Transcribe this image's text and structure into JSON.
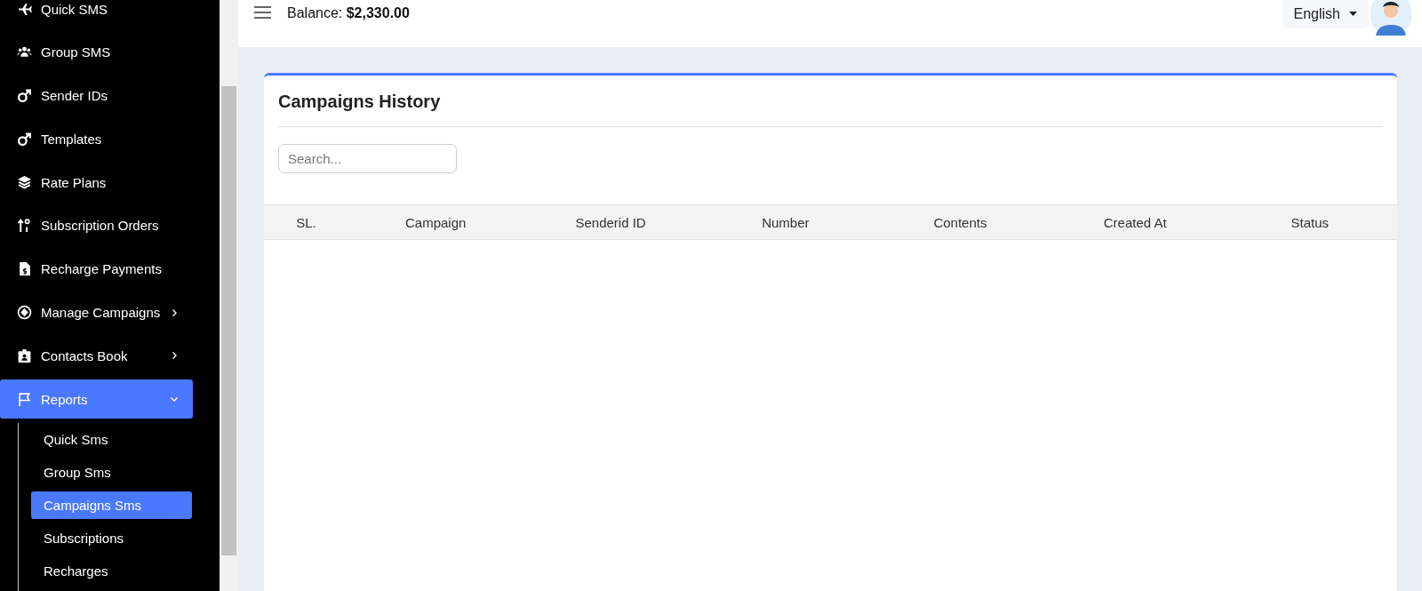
{
  "sidebar": {
    "items": [
      {
        "label": "Quick SMS",
        "selected": false
      },
      {
        "label": "Group SMS",
        "selected": false
      },
      {
        "label": "Sender IDs",
        "selected": false
      },
      {
        "label": "Templates",
        "selected": false
      },
      {
        "label": "Rate Plans",
        "selected": false
      },
      {
        "label": "Subscription Orders",
        "selected": false
      },
      {
        "label": "Recharge Payments",
        "selected": false
      },
      {
        "label": "Manage Campaigns",
        "selected": false,
        "expanded": false
      },
      {
        "label": "Contacts Book",
        "selected": false,
        "expanded": false
      },
      {
        "label": "Reports",
        "selected": true,
        "expanded": true,
        "children": [
          {
            "label": "Quick Sms",
            "selected": false
          },
          {
            "label": "Group Sms",
            "selected": false
          },
          {
            "label": "Campaigns Sms",
            "selected": true
          },
          {
            "label": "Subscriptions",
            "selected": false
          },
          {
            "label": "Recharges",
            "selected": false
          }
        ]
      }
    ]
  },
  "topbar": {
    "balance_label": "Balance:",
    "balance_value": "$2,330.00",
    "language": "English"
  },
  "card": {
    "title": "Campaigns History",
    "search": {
      "placeholder": "Search..."
    },
    "table": {
      "columns": [
        "SL.",
        "Campaign",
        "Senderid ID",
        "Number",
        "Contents",
        "Created At",
        "Status"
      ]
    }
  }
}
